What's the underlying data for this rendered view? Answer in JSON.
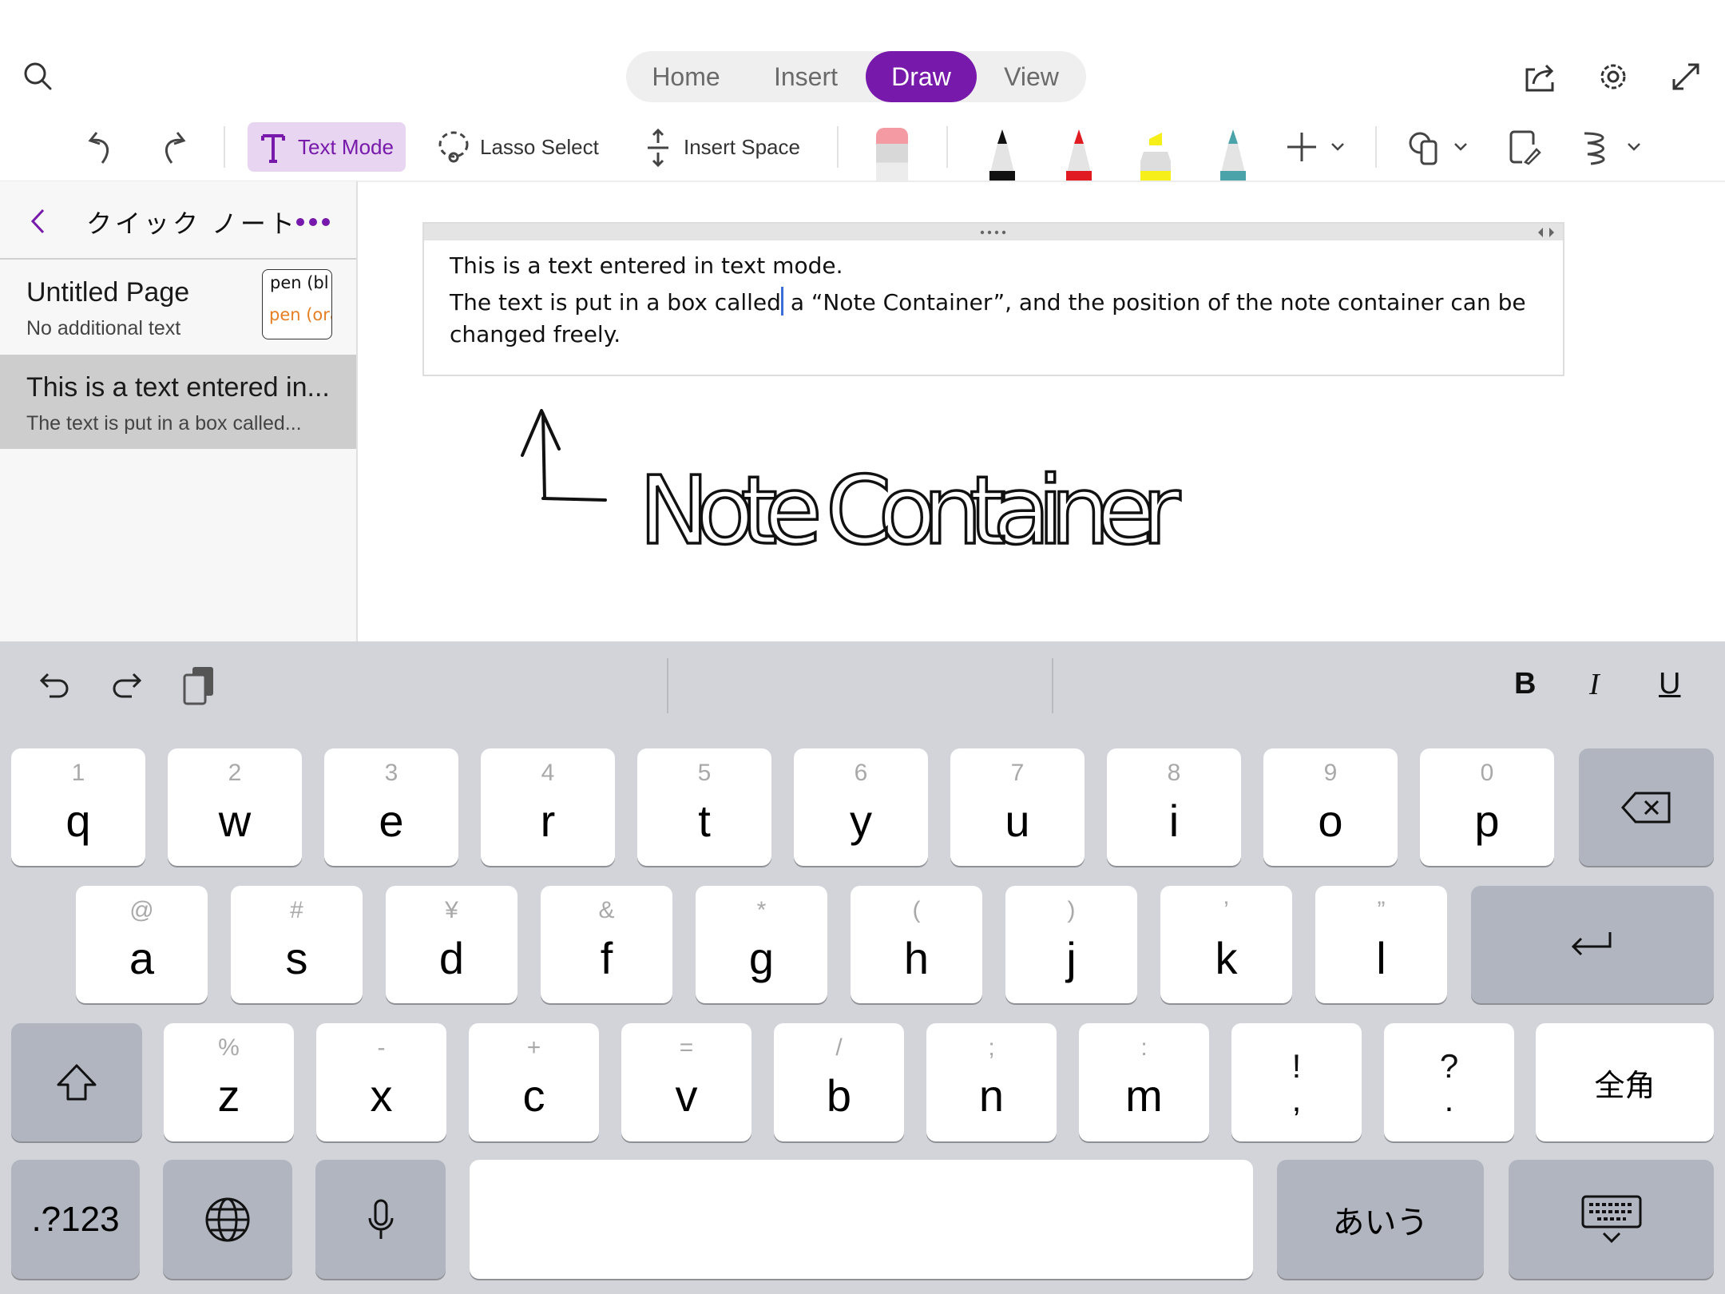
{
  "ribbon": {
    "tabs": [
      {
        "label": "Home"
      },
      {
        "label": "Insert"
      },
      {
        "label": "Draw",
        "active": true
      },
      {
        "label": "View"
      }
    ],
    "accent_color": "#7719aa"
  },
  "toolbar": {
    "text_mode": "Text Mode",
    "lasso_select": "Lasso Select",
    "insert_space": "Insert Space",
    "pens": [
      {
        "name": "black-pen",
        "color": "#111111"
      },
      {
        "name": "red-pen",
        "color": "#e11b22"
      },
      {
        "name": "yellow-highlighter",
        "color": "#f6ef1a"
      },
      {
        "name": "galaxy-pen",
        "color": "#4aa3a8"
      }
    ]
  },
  "sidebar": {
    "title": "クイック ノート",
    "pages": [
      {
        "title": "Untitled Page",
        "preview": "No additional text",
        "thumb_line1": "pen (bl",
        "thumb_line2": "pen (ora"
      },
      {
        "title": "This is a text entered in...",
        "preview": "The text is put in a box called...",
        "selected": true
      }
    ]
  },
  "note": {
    "line1": "This is a text entered in text mode.",
    "line2a": "The text is put in a box called",
    "line2b": " a “Note Container”, and the position of the note container can be",
    "line3": "changed freely.",
    "handwriting": "Note Container"
  },
  "keyboard": {
    "format": {
      "bold": "B",
      "italic": "I",
      "underline": "U"
    },
    "row1": [
      [
        "1",
        "q"
      ],
      [
        "2",
        "w"
      ],
      [
        "3",
        "e"
      ],
      [
        "4",
        "r"
      ],
      [
        "5",
        "t"
      ],
      [
        "6",
        "y"
      ],
      [
        "7",
        "u"
      ],
      [
        "8",
        "i"
      ],
      [
        "9",
        "o"
      ],
      [
        "0",
        "p"
      ]
    ],
    "row2": [
      [
        "@",
        "a"
      ],
      [
        "#",
        "s"
      ],
      [
        "¥",
        "d"
      ],
      [
        "&",
        "f"
      ],
      [
        "*",
        "g"
      ],
      [
        "(",
        "h"
      ],
      [
        ")",
        "j"
      ],
      [
        "’",
        "k"
      ],
      [
        "”",
        "l"
      ]
    ],
    "row3": [
      [
        "%",
        "z"
      ],
      [
        "-",
        "x"
      ],
      [
        "+",
        "c"
      ],
      [
        "=",
        "v"
      ],
      [
        "/",
        "b"
      ],
      [
        ";",
        "n"
      ],
      [
        ":",
        "m"
      ],
      [
        "!",
        ","
      ],
      [
        "?",
        "."
      ]
    ],
    "zenkaku": "全角",
    "numbers": ".?123",
    "kana": "あいう"
  }
}
